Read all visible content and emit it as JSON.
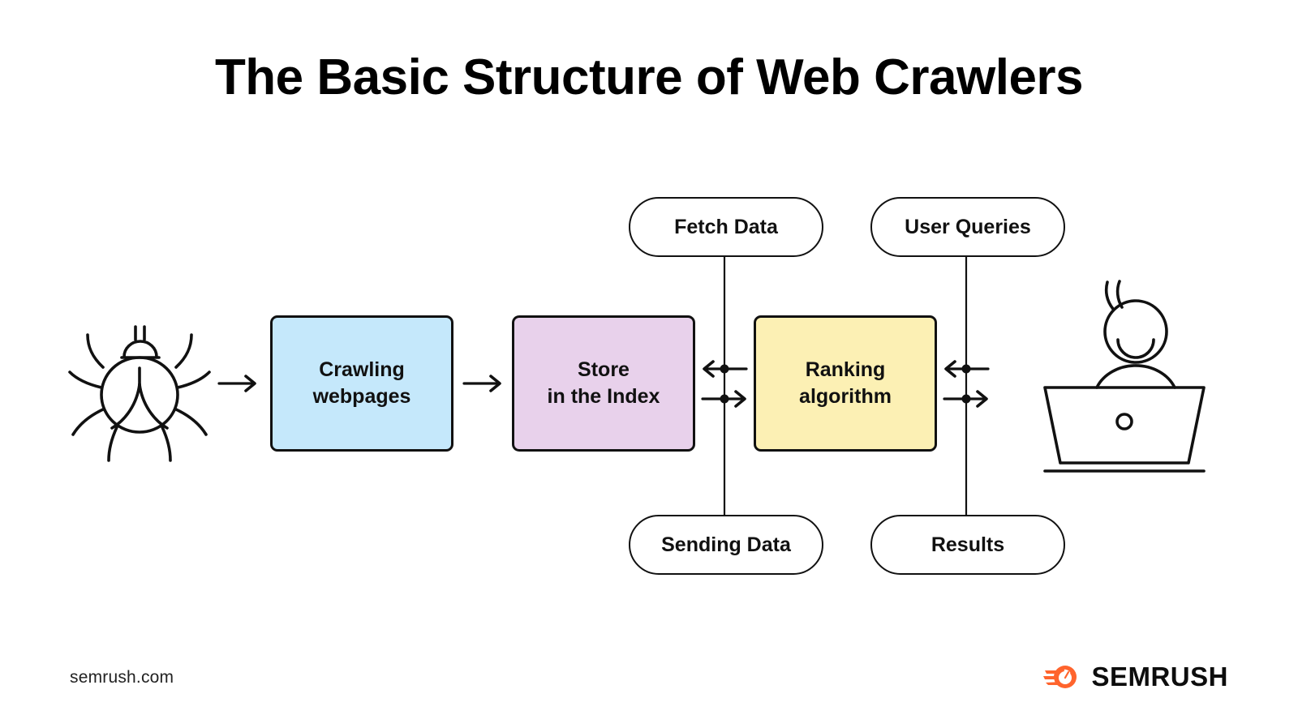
{
  "page": {
    "title": "The Basic Structure of Web Crawlers",
    "background_color": "#ffffff"
  },
  "footer": {
    "url": "semrush.com",
    "brand": "SEMRUSH",
    "brand_icon": "semrush-comet-icon",
    "brand_color": "#FF642D"
  },
  "diagram": {
    "type": "flowchart",
    "icons": {
      "crawler": {
        "name": "spider-bug-icon",
        "label": "Web crawler spider"
      },
      "user": {
        "name": "person-at-laptop-icon",
        "label": "User at laptop"
      }
    },
    "boxes": [
      {
        "id": "crawling",
        "label": "Crawling\nwebpages",
        "line1": "Crawling",
        "line2": "webpages",
        "color": "#C5E8FB"
      },
      {
        "id": "store",
        "label": "Store\nin the Index",
        "line1": "Store",
        "line2": "in the Index",
        "color": "#E8D1EB"
      },
      {
        "id": "ranking",
        "label": "Ranking\nalgorithm",
        "line1": "Ranking",
        "line2": "algorithm",
        "color": "#FCF0B4"
      }
    ],
    "pills": [
      {
        "id": "fetch-data",
        "label": "Fetch Data",
        "position": "top-left"
      },
      {
        "id": "user-queries",
        "label": "User Queries",
        "position": "top-right"
      },
      {
        "id": "sending-data",
        "label": "Sending Data",
        "position": "bottom-left"
      },
      {
        "id": "results",
        "label": "Results",
        "position": "bottom-right"
      }
    ],
    "connections": [
      {
        "from": "crawler-icon",
        "to": "crawling",
        "style": "arrow-right"
      },
      {
        "from": "crawling",
        "to": "store",
        "style": "arrow-right"
      },
      {
        "from": "ranking",
        "to": "store",
        "style": "arrow-left",
        "label": "Fetch Data"
      },
      {
        "from": "store",
        "to": "ranking",
        "style": "arrow-right",
        "label": "Sending Data"
      },
      {
        "from": "user",
        "to": "ranking",
        "style": "arrow-left",
        "label": "User Queries"
      },
      {
        "from": "ranking",
        "to": "user",
        "style": "arrow-right",
        "label": "Results"
      }
    ]
  }
}
